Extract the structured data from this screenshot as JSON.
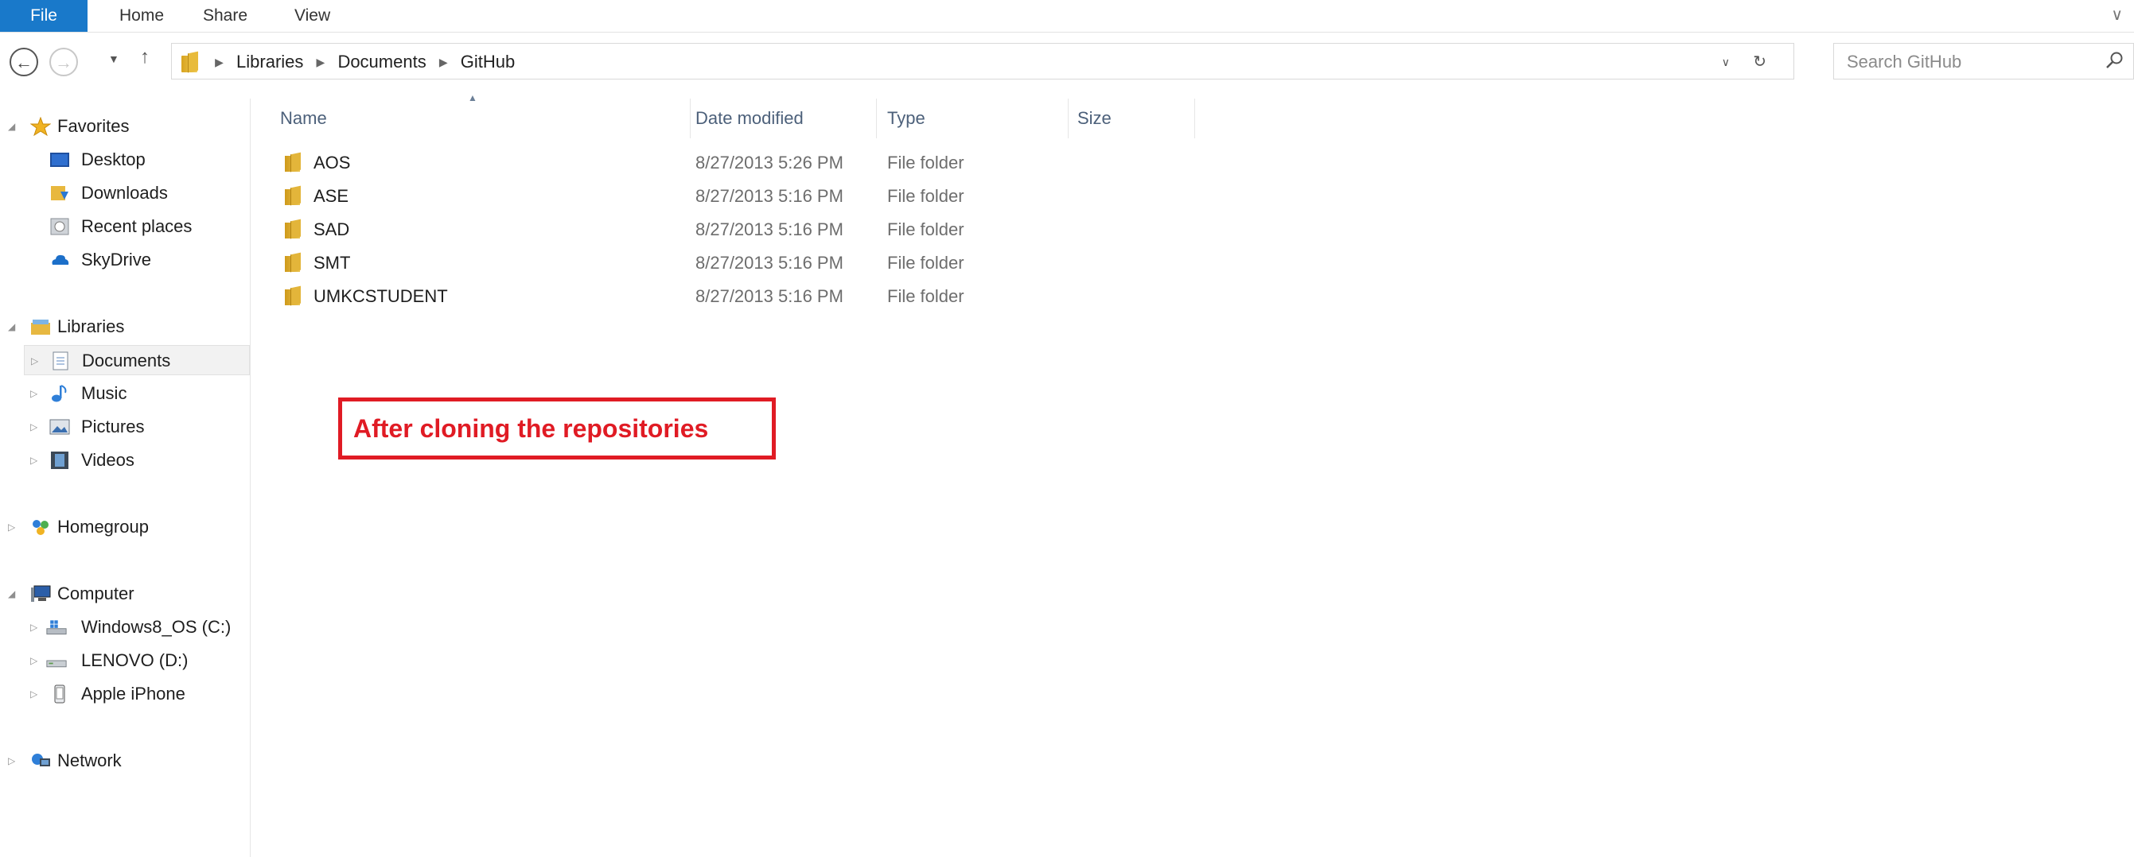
{
  "ribbon": {
    "tabs": [
      "File",
      "Home",
      "Share",
      "View"
    ]
  },
  "address": {
    "crumbs": [
      "Libraries",
      "Documents",
      "GitHub"
    ]
  },
  "search": {
    "placeholder": "Search GitHub"
  },
  "sidebar": {
    "favorites": {
      "label": "Favorites",
      "items": [
        "Desktop",
        "Downloads",
        "Recent places",
        "SkyDrive"
      ]
    },
    "libraries": {
      "label": "Libraries",
      "items": [
        "Documents",
        "Music",
        "Pictures",
        "Videos"
      ],
      "selected": "Documents"
    },
    "homegroup": {
      "label": "Homegroup"
    },
    "computer": {
      "label": "Computer",
      "items": [
        "Windows8_OS (C:)",
        "LENOVO (D:)",
        "Apple iPhone"
      ]
    },
    "network": {
      "label": "Network"
    }
  },
  "columns": [
    "Name",
    "Date modified",
    "Type",
    "Size"
  ],
  "files": [
    {
      "name": "AOS",
      "date": "8/27/2013 5:26 PM",
      "type": "File folder"
    },
    {
      "name": "ASE",
      "date": "8/27/2013 5:16 PM",
      "type": "File folder"
    },
    {
      "name": "SAD",
      "date": "8/27/2013 5:16 PM",
      "type": "File folder"
    },
    {
      "name": "SMT",
      "date": "8/27/2013 5:16 PM",
      "type": "File folder"
    },
    {
      "name": "UMKCSTUDENT",
      "date": "8/27/2013 5:16 PM",
      "type": "File folder"
    }
  ],
  "annotation": "After cloning the repositories",
  "colors": {
    "file_tab": "#1979ca",
    "annotation": "#e01b24",
    "header_text": "#4c607a"
  }
}
